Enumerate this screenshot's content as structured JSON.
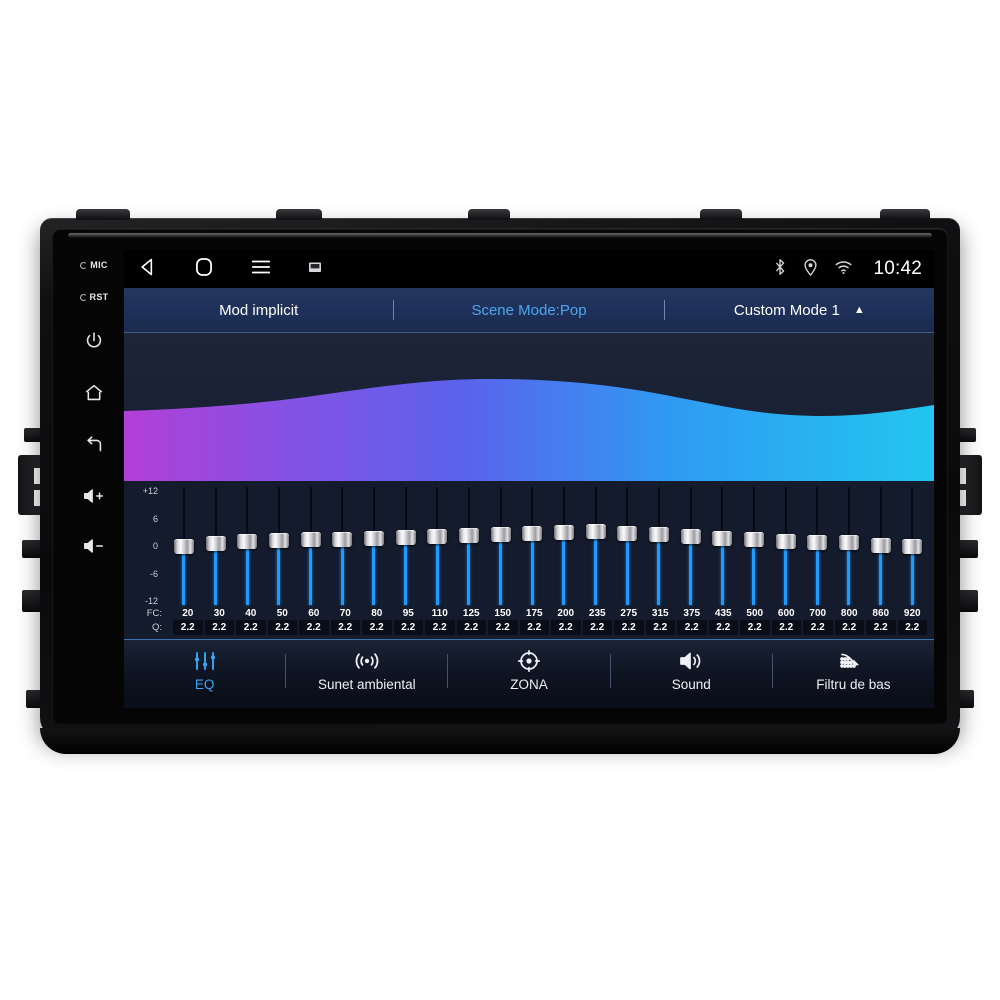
{
  "device": {
    "side_keys": [
      {
        "name": "mic-label",
        "label": "MIC"
      },
      {
        "name": "rst-label",
        "label": "RST"
      },
      {
        "name": "power-icon",
        "label": ""
      },
      {
        "name": "home-icon",
        "label": ""
      },
      {
        "name": "back-icon",
        "label": ""
      },
      {
        "name": "volume-up-icon",
        "label": ""
      },
      {
        "name": "volume-down-icon",
        "label": ""
      }
    ]
  },
  "statusbar": {
    "nav_icons": [
      "back-icon",
      "home-icon",
      "menu-icon",
      "screenshot-icon"
    ],
    "sys_icons": [
      "bluetooth-icon",
      "location-icon",
      "wifi-icon"
    ],
    "clock": "10:42"
  },
  "mode_row": {
    "default_mode": "Mod implicit",
    "scene_mode": "Scene Mode:Pop",
    "custom_mode": "Custom Mode 1",
    "caret": "▲",
    "accent_color": "#4aa8f0"
  },
  "curve": {
    "gradient_stops": [
      "#b23fd6",
      "#6a5bea",
      "#2f9bf2",
      "#22c6f0"
    ],
    "background": "#1a2236"
  },
  "equalizer": {
    "scale_labels": [
      "+12",
      "6",
      "0",
      "-6",
      "-12"
    ],
    "fc_label": "FC:",
    "q_label": "Q:",
    "bands": [
      {
        "fc": "20",
        "q": "2.2",
        "value": 0
      },
      {
        "fc": "30",
        "q": "2.2",
        "value": 0.5
      },
      {
        "fc": "40",
        "q": "2.2",
        "value": 1.0
      },
      {
        "fc": "50",
        "q": "2.2",
        "value": 1.2
      },
      {
        "fc": "60",
        "q": "2.2",
        "value": 1.4
      },
      {
        "fc": "70",
        "q": "2.2",
        "value": 1.6
      },
      {
        "fc": "80",
        "q": "2.2",
        "value": 1.8
      },
      {
        "fc": "95",
        "q": "2.2",
        "value": 2.0
      },
      {
        "fc": "110",
        "q": "2.2",
        "value": 2.2
      },
      {
        "fc": "125",
        "q": "2.2",
        "value": 2.4
      },
      {
        "fc": "150",
        "q": "2.2",
        "value": 2.6
      },
      {
        "fc": "175",
        "q": "2.2",
        "value": 2.9
      },
      {
        "fc": "200",
        "q": "2.2",
        "value": 3.2
      },
      {
        "fc": "235",
        "q": "2.2",
        "value": 3.4
      },
      {
        "fc": "275",
        "q": "2.2",
        "value": 3.0
      },
      {
        "fc": "315",
        "q": "2.2",
        "value": 2.7
      },
      {
        "fc": "375",
        "q": "2.2",
        "value": 2.2
      },
      {
        "fc": "435",
        "q": "2.2",
        "value": 1.8
      },
      {
        "fc": "500",
        "q": "2.2",
        "value": 1.4
      },
      {
        "fc": "600",
        "q": "2.2",
        "value": 1.1
      },
      {
        "fc": "700",
        "q": "2.2",
        "value": 0.9
      },
      {
        "fc": "800",
        "q": "2.2",
        "value": 0.8
      },
      {
        "fc": "860",
        "q": "2.2",
        "value": 0.2
      },
      {
        "fc": "920",
        "q": "2.2",
        "value": -0.2
      }
    ]
  },
  "bottom_nav": {
    "items": [
      {
        "label": "EQ",
        "icon": "equalizer-icon",
        "active": true
      },
      {
        "label": "Sunet ambiental",
        "icon": "surround-sound-icon",
        "active": false
      },
      {
        "label": "ZONA",
        "icon": "zone-target-icon",
        "active": false
      },
      {
        "label": "Sound",
        "icon": "speaker-icon",
        "active": false
      },
      {
        "label": "Filtru de bas",
        "icon": "bass-filter-icon",
        "active": false
      }
    ],
    "active_color": "#38a8f5"
  }
}
